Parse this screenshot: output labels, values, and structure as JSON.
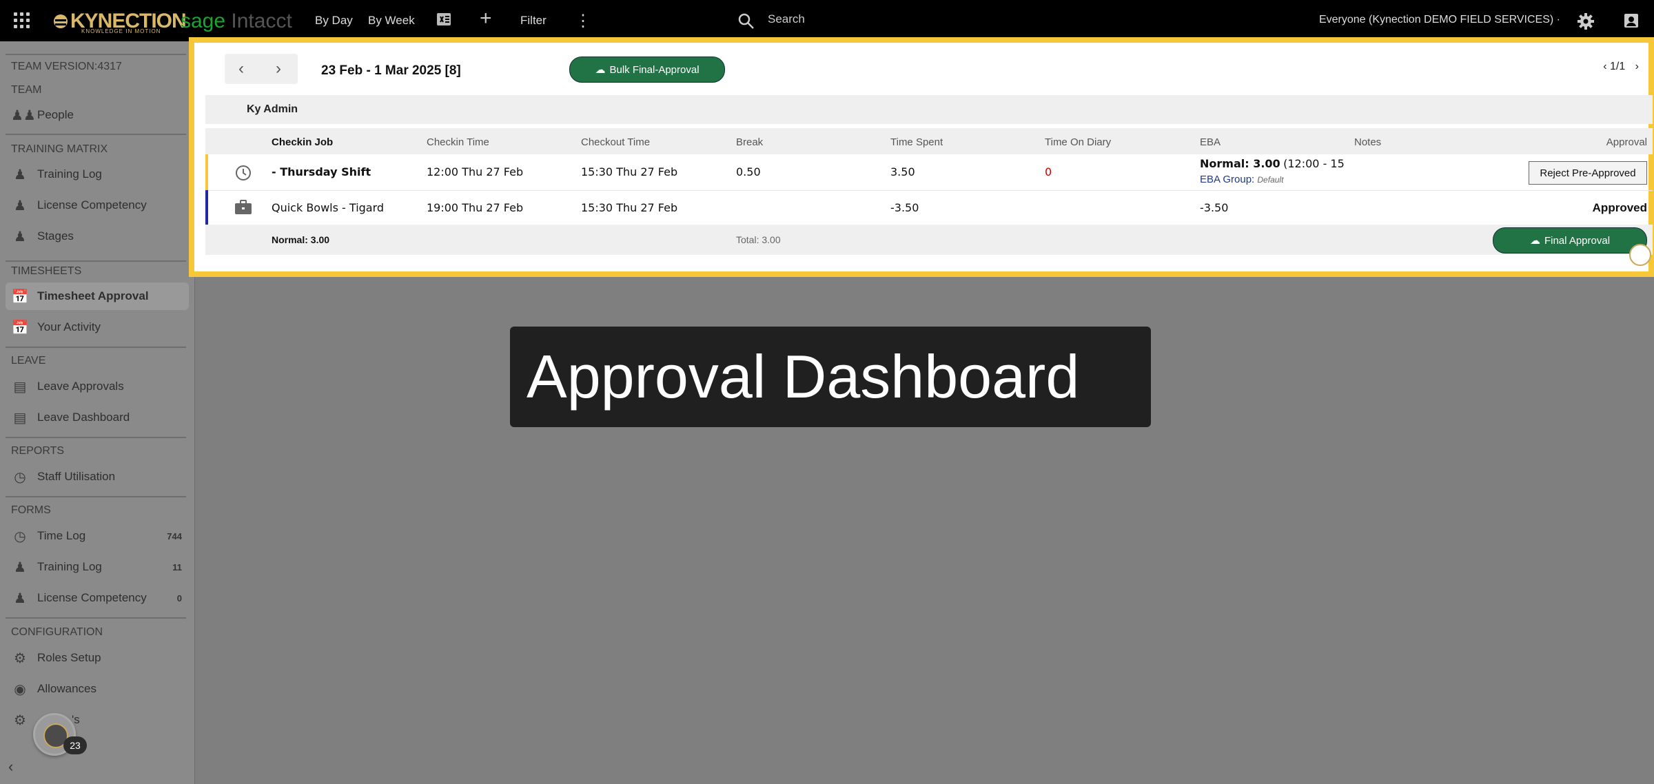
{
  "topbar": {
    "logo_text": "KYNECTION",
    "logo_tagline": "KNOWLEDGE IN MOTION",
    "sage_text": "sage",
    "intacct_text": "Intacct",
    "by_day": "By Day",
    "by_week": "By Week",
    "filter": "Filter",
    "search_label": "Search",
    "context": "Everyone (Kynection DEMO FIELD SERVICES) ·"
  },
  "sidebar": {
    "version": "TEAM VERSION:4317",
    "sections": {
      "team": "TEAM",
      "training_matrix": "TRAINING MATRIX",
      "timesheets": "TIMESHEETS",
      "leave": "LEAVE",
      "reports": "REPORTS",
      "forms": "FORMS",
      "configuration": "CONFIGURATION"
    },
    "items": {
      "people": "People",
      "training_log": "Training Log",
      "license_competency": "License Competency",
      "stages": "Stages",
      "timesheet_approval": "Timesheet Approval",
      "your_activity": "Your Activity",
      "leave_approvals": "Leave Approvals",
      "leave_dashboard": "Leave Dashboard",
      "staff_utilisation": "Staff Utilisation",
      "time_log": "Time Log",
      "forms_training_log": "Training Log",
      "forms_license_competency": "License Competency",
      "roles_setup": "Roles Setup",
      "allowances": "Allowances",
      "partial": "'s"
    },
    "counts": {
      "time_log": "744",
      "training_log": "11",
      "license_competency": "0"
    },
    "badge": "23"
  },
  "panel": {
    "date_range": "23 Feb - 1 Mar 2025 [8]",
    "bulk_button": "Bulk Final-Approval",
    "pager": "1/1",
    "employee": "Ky Admin",
    "columns": {
      "job": "Checkin Job",
      "checkin": "Checkin Time",
      "checkout": "Checkout Time",
      "break": "Break",
      "spent": "Time Spent",
      "diary": "Time On Diary",
      "eba": "EBA",
      "notes": "Notes",
      "approval": "Approval"
    },
    "rows": [
      {
        "job": "- Thursday Shift",
        "checkin": "12:00 Thu 27 Feb",
        "checkout": "15:30 Thu 27 Feb",
        "break": "0.50",
        "spent": "3.50",
        "diary": "0",
        "eba_main": "Normal: 3.00",
        "eba_range": "(12:00 - 15:",
        "eba_group_label": "EBA Group:",
        "eba_group_value": "Default",
        "action": "Reject Pre-Approved"
      },
      {
        "job": "Quick Bowls - Tigard",
        "checkin": "19:00 Thu 27 Feb",
        "checkout": "15:30 Thu 27 Feb",
        "break": "",
        "spent": "-3.50",
        "diary": "",
        "eba_main": "-3.50",
        "status": "Approved"
      }
    ],
    "footer_normal": "Normal: 3.00",
    "footer_total": "Total: 3.00",
    "final_button": "Final Approval"
  },
  "caption": "Approval Dashboard",
  "colors": {
    "accent_yellow": "#f5c739",
    "green": "#217346",
    "row1_bar": "#f5c739",
    "row2_bar": "#1f2aa0"
  }
}
